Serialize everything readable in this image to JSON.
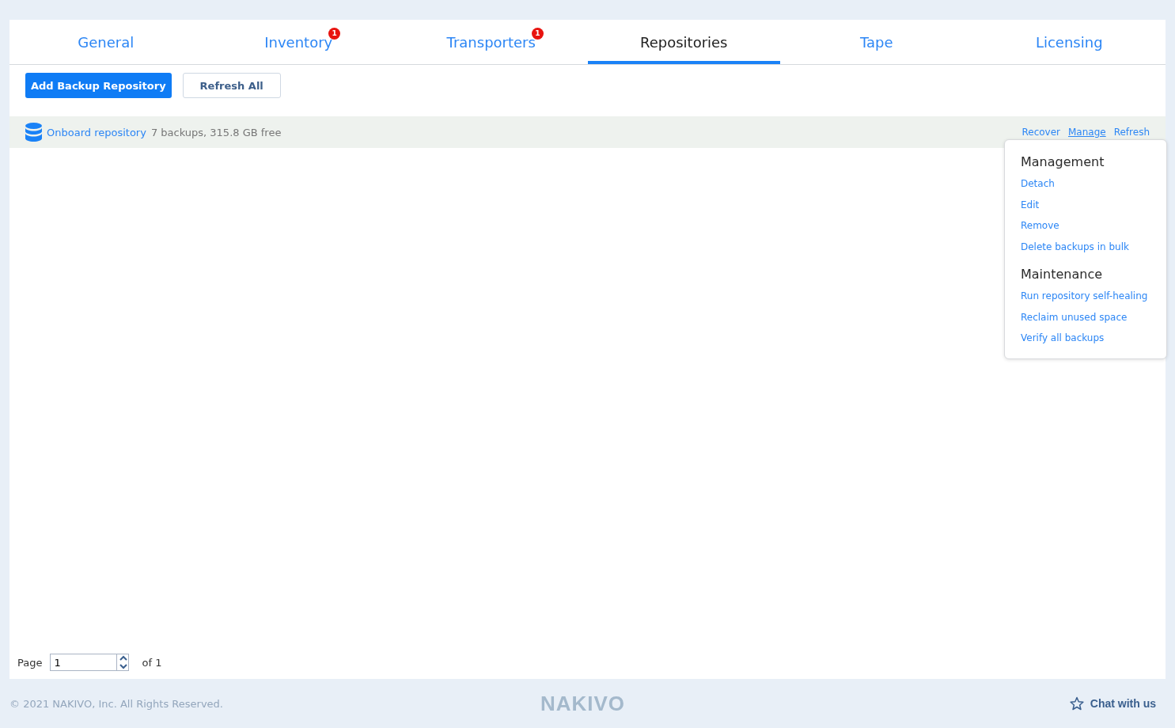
{
  "tabs": [
    {
      "label": "General",
      "selected": false
    },
    {
      "label": "Inventory",
      "selected": false,
      "badge": "1"
    },
    {
      "label": "Transporters",
      "selected": false,
      "badge": "1"
    },
    {
      "label": "Repositories",
      "selected": true
    },
    {
      "label": "Tape",
      "selected": false
    },
    {
      "label": "Licensing",
      "selected": false
    }
  ],
  "toolbar": {
    "primary_button": "Add Backup Repository",
    "secondary_button": "Refresh All"
  },
  "repository": {
    "name": "Onboard repository",
    "details": "7 backups, 315.8 GB free",
    "actions": [
      {
        "label": "Recover",
        "hovered": false
      },
      {
        "label": "Manage",
        "hovered": true
      },
      {
        "label": "Refresh",
        "hovered": false
      }
    ]
  },
  "menu": {
    "sections": [
      {
        "title": "Management",
        "items": [
          "Detach",
          "Edit",
          "Remove",
          "Delete backups in bulk"
        ]
      },
      {
        "title": "Maintenance",
        "items": [
          "Run repository self-healing",
          "Reclaim unused space",
          "Verify all backups"
        ]
      }
    ]
  },
  "pager": {
    "label": "Page",
    "value": "1",
    "total": "of 1"
  },
  "footer": {
    "copyright": "© 2021 NAKIVO, Inc. All Rights Reserved.",
    "logo": "NAKIVO",
    "chat": "Chat with us"
  }
}
